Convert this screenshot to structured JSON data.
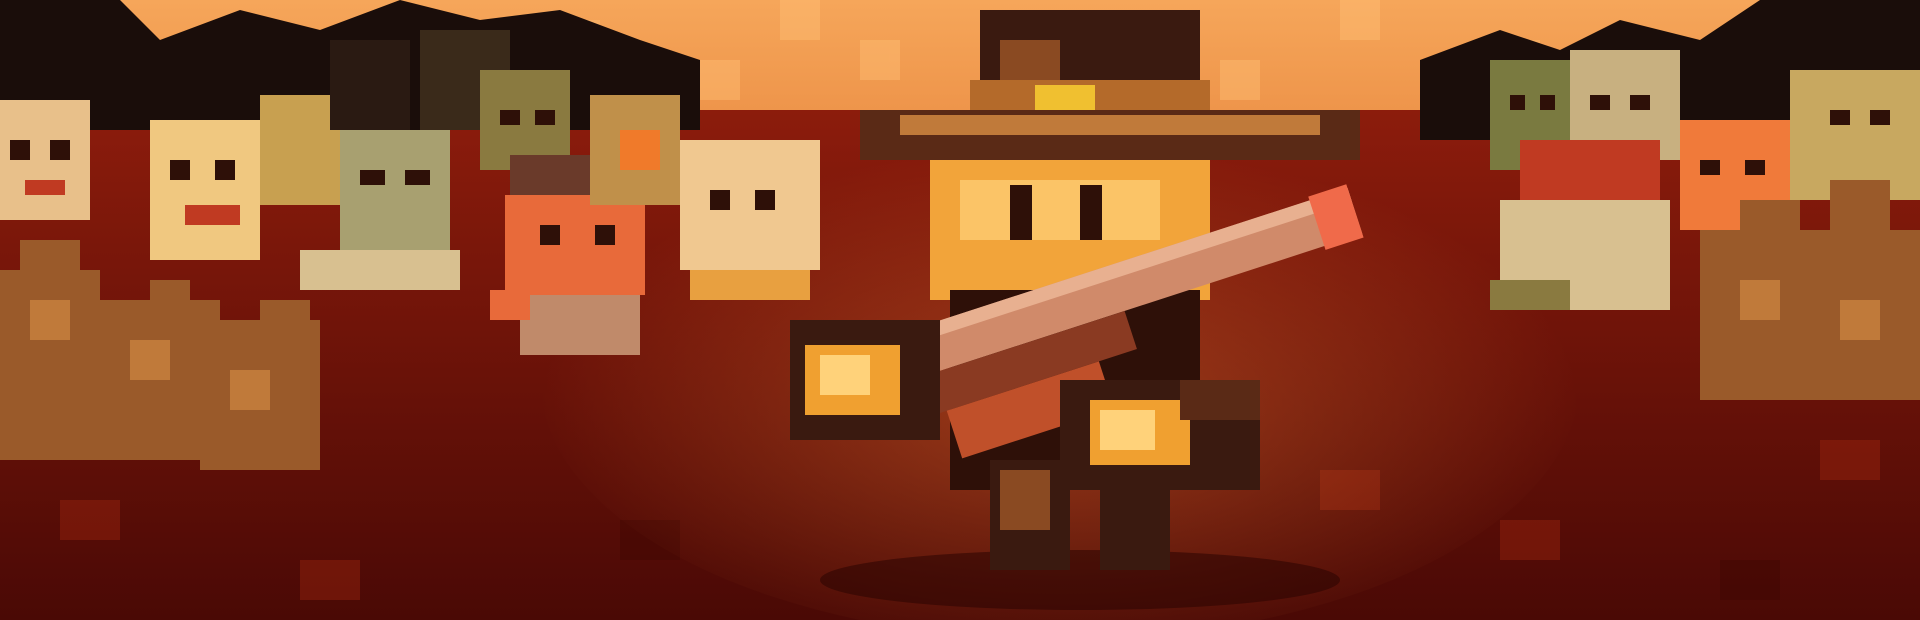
{
  "scene": {
    "palette": {
      "sky_top": "#f6a65a",
      "sky_bottom": "#e8873e",
      "ground_top": "#8c1c0c",
      "ground_bottom": "#4a0905",
      "treeline": "#1a0d0a",
      "hat_dark": "#3a1a10",
      "hat_band": "#b46a2a",
      "hat_buckle": "#f0c030",
      "skin": "#f2a43a",
      "skin_light": "#ffd27a",
      "rifle_wood": "#8a3a22",
      "rifle_barrel": "#d08a6a",
      "rifle_tip": "#f06a4a",
      "cloth_dark": "#2e1008",
      "zombie_pale": "#e8c08a",
      "zombie_green": "#a8a070",
      "zombie_red": "#c03a22",
      "bush": "#9a5a2a"
    },
    "characters": [
      {
        "id": "gunslinger-hero",
        "icon": "cowboy-hat-rifle-character"
      },
      {
        "id": "horde-left",
        "icon": "zombie-horde-left"
      },
      {
        "id": "horde-right",
        "icon": "zombie-horde-right"
      }
    ]
  }
}
